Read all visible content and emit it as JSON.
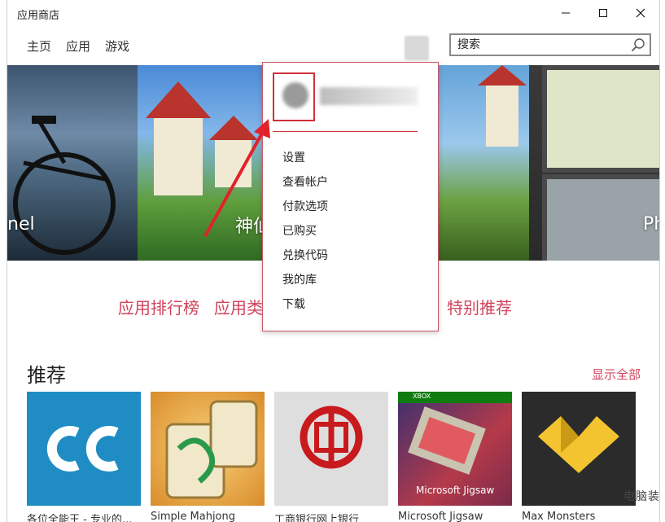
{
  "window": {
    "title": "应用商店"
  },
  "nav": [
    "主页",
    "应用",
    "游戏"
  ],
  "search": {
    "placeholder": "搜索"
  },
  "hero": {
    "tile1_text": "nel",
    "tile2_text": "神仙",
    "tile4_text": "Ph"
  },
  "categories": [
    "应用排行榜",
    "应用类",
    "类别",
    "特别推荐"
  ],
  "section": {
    "title": "推荐",
    "show_all": "显示全部"
  },
  "cards": [
    {
      "title": "各位全能王 - 专业的..."
    },
    {
      "title": "Simple Mahjong"
    },
    {
      "title": "工商银行网上银行"
    },
    {
      "title": "Microsoft Jigsaw"
    },
    {
      "title": "Max Monsters"
    }
  ],
  "card_overlays": {
    "jigsaw_label": "Microsoft Jigsaw",
    "xbox_badge": "XBOX"
  },
  "menu": {
    "items": [
      "设置",
      "查看帐户",
      "付款选项",
      "已购买",
      "兑换代码",
      "我的库",
      "下载"
    ]
  },
  "watermark": "电脑装",
  "colors": {
    "accent": "#d2435b",
    "highlight": "#d0303a"
  }
}
